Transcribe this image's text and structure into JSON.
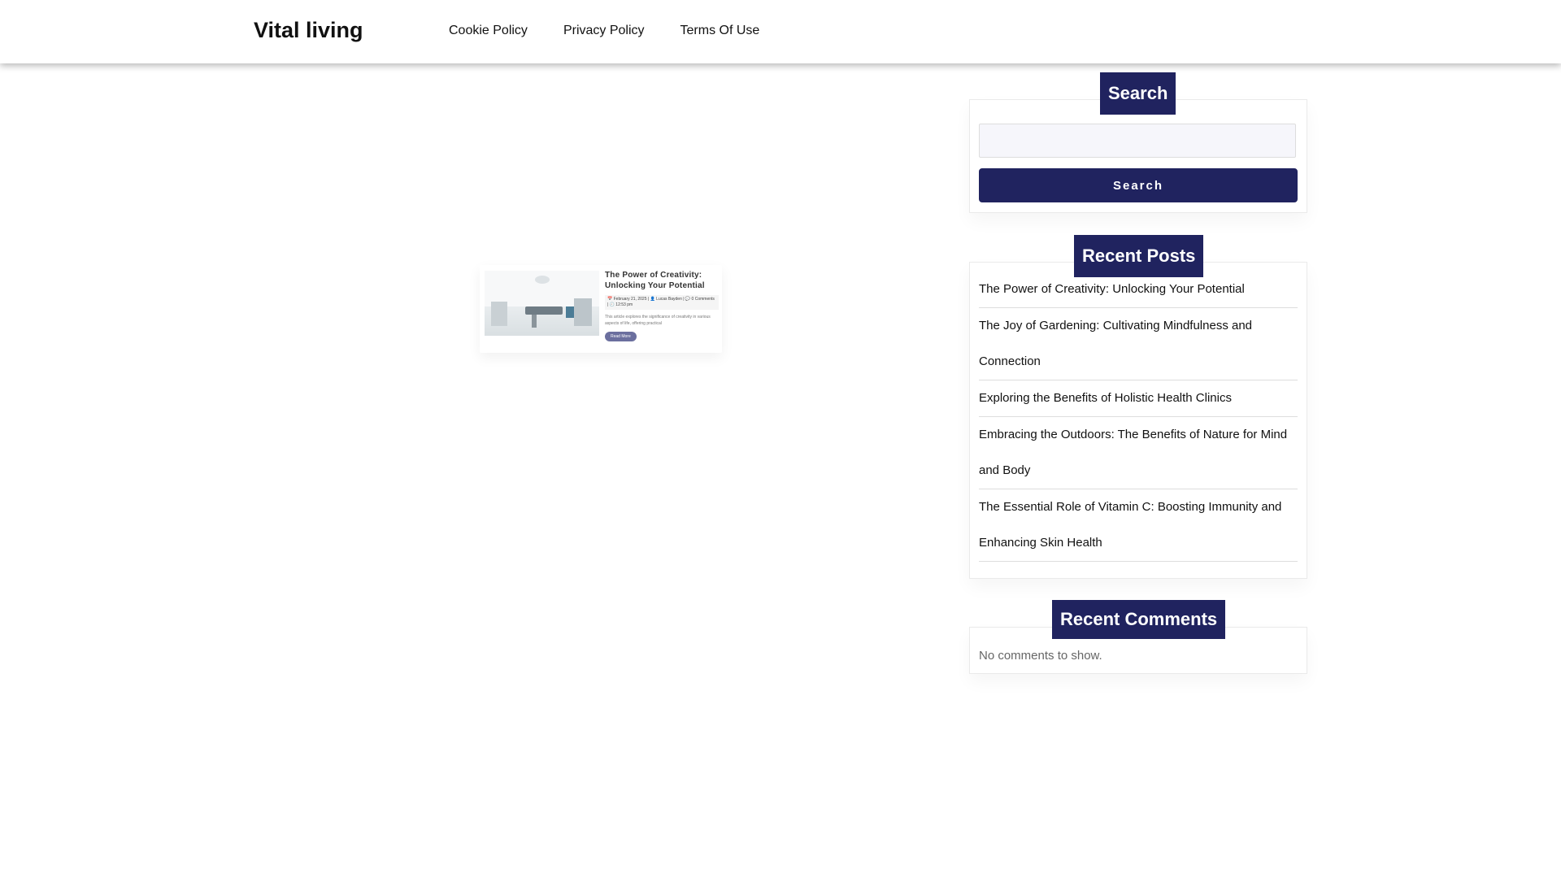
{
  "site": {
    "title": "Vital living"
  },
  "nav": {
    "items": [
      "Cookie Policy",
      "Privacy Policy",
      "Terms Of Use"
    ]
  },
  "post": {
    "title": "The Power of Creativity: Unlocking Your Potential",
    "meta": "📅 February 21, 2025 | 👤 Lucas Bayden | 💬 0 Comments | 🕘 12:53 pm",
    "excerpt": "This article explores the significance of creativity in various aspects of life, offering practical",
    "read_more": "Read More"
  },
  "sidebar": {
    "search": {
      "title": "Search",
      "placeholder": "",
      "button_label": "Search"
    },
    "recent_posts": {
      "title": "Recent Posts",
      "items": [
        "The Power of Creativity: Unlocking Your Potential",
        "The Joy of Gardening: Cultivating Mindfulness and Connection",
        "Exploring the Benefits of Holistic Health Clinics",
        "Embracing the Outdoors: The Benefits of Nature for Mind and Body",
        "The Essential Role of Vitamin C: Boosting Immunity and Enhancing Skin Health"
      ]
    },
    "recent_comments": {
      "title": "Recent Comments",
      "empty_text": "No comments to show."
    }
  },
  "colors": {
    "accent": "#20235f",
    "read_more": "#6b6f9e"
  }
}
